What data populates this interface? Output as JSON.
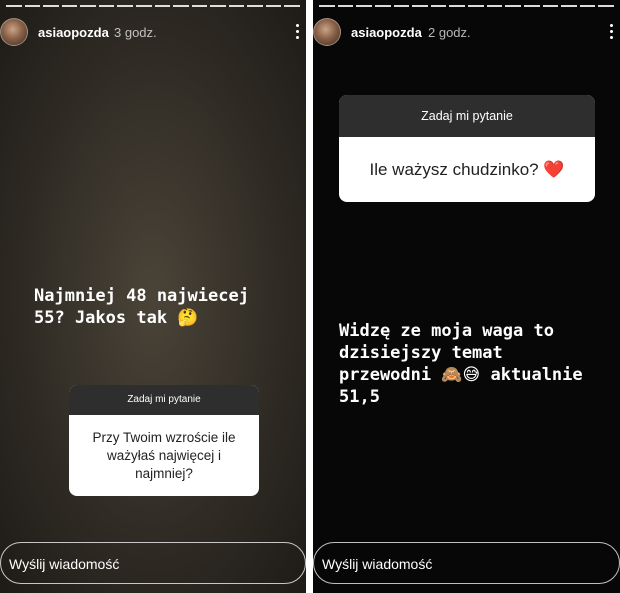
{
  "stories": [
    {
      "username": "asiaopozda",
      "time": "3 godz.",
      "question_header": "Zadaj mi pytanie",
      "question_text": "Przy Twoim wzroście ile ważyłaś najwięcej i najmniej?",
      "answer_text": "Najmniej 48 najwiecej\n55? Jakos tak",
      "answer_emoji": "🤔",
      "message_placeholder": "Wyślij wiadomość"
    },
    {
      "username": "asiaopozda",
      "time": "2 godz.",
      "question_header": "Zadaj mi pytanie",
      "question_text": "Ile ważysz chudzinko? ❤️",
      "answer_text_1": "Widzę ze moja waga to\ndzisiejszy temat\nprzewodni",
      "answer_emoji": "🙈😅",
      "answer_text_2": "aktualnie\n51,5",
      "message_placeholder": "Wyślij wiadomość"
    }
  ],
  "colors": {
    "left_background": "#3a352c",
    "right_background": "#070707",
    "question_header_bg": "#2e2e2e",
    "question_body_bg": "#ffffff"
  },
  "icons": [
    "profile-avatar",
    "more-options-icon"
  ]
}
